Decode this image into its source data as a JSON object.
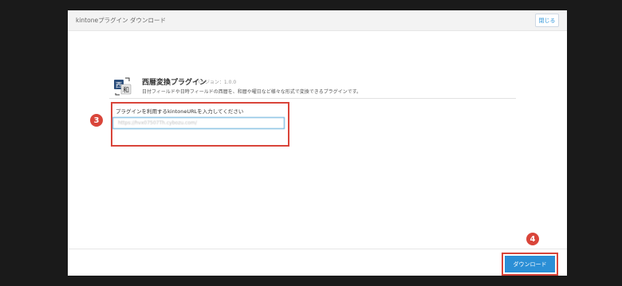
{
  "dialog": {
    "title": "kintoneプラグイン ダウンロード",
    "close_label": "閉じる"
  },
  "plugin": {
    "icon": "japanese-calendar-plugin-icon",
    "name": "西暦変換プラグイン",
    "version": "バージョン：1.0.0",
    "description": "日付フィールドや日時フィールドの西暦を、和暦や曜日など様々な形式で変換できるプラグインです。"
  },
  "url_field": {
    "label": "プラグインを利用するkintoneURLを入力してください",
    "value": "https://hvx07507Th.cybozu.com/"
  },
  "steps": {
    "url_step": "3",
    "download_step": "4"
  },
  "download_label": "ダウンロード",
  "colors": {
    "accent": "#2b8fd6",
    "highlight": "#d9453a",
    "backdrop": "#1a1a1a"
  }
}
